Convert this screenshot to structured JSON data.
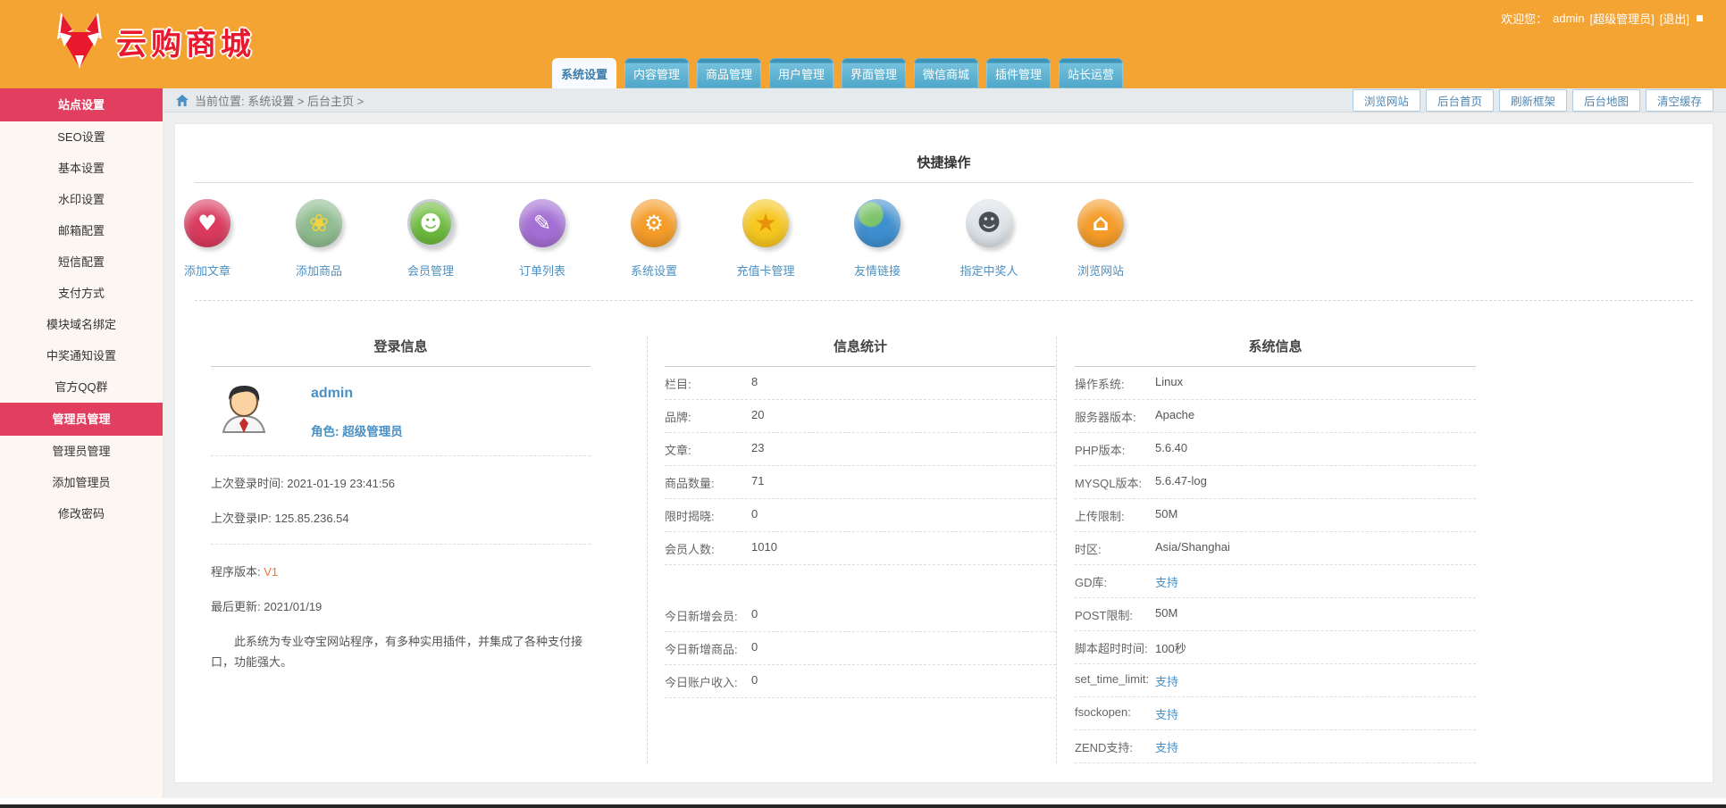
{
  "colors": {
    "header_bg": "#F3A433",
    "accent_pink": "#E23E60",
    "tab_blue": "#55A9CC",
    "link_blue": "#4A90C4",
    "version_orange": "#E87540"
  },
  "header": {
    "logo_text": "云购商城",
    "welcome_prefix": "欢迎您：",
    "username": "admin",
    "role_badge": "[超级管理员]",
    "logout": "[退出]"
  },
  "tabs": [
    {
      "label": "系统设置",
      "active": true
    },
    {
      "label": "内容管理",
      "active": false
    },
    {
      "label": "商品管理",
      "active": false
    },
    {
      "label": "用户管理",
      "active": false
    },
    {
      "label": "界面管理",
      "active": false
    },
    {
      "label": "微信商城",
      "active": false
    },
    {
      "label": "插件管理",
      "active": false
    },
    {
      "label": "站长运营",
      "active": false
    }
  ],
  "breadcrumb": {
    "text": "当前位置: 系统设置 > 后台主页 >"
  },
  "toolbar": {
    "browse_site": "浏览网站",
    "admin_home": "后台首页",
    "refresh_frame": "刷新框架",
    "admin_map": "后台地图",
    "clear_cache": "清空缓存"
  },
  "sidebar": {
    "items": [
      {
        "label": "站点设置",
        "active": true
      },
      {
        "label": "SEO设置",
        "active": false
      },
      {
        "label": "基本设置",
        "active": false
      },
      {
        "label": "水印设置",
        "active": false
      },
      {
        "label": "邮箱配置",
        "active": false
      },
      {
        "label": "短信配置",
        "active": false
      },
      {
        "label": "支付方式",
        "active": false
      },
      {
        "label": "模块域名绑定",
        "active": false
      },
      {
        "label": "中奖通知设置",
        "active": false
      },
      {
        "label": "官方QQ群",
        "active": false
      },
      {
        "label": "管理员管理",
        "active": true
      },
      {
        "label": "管理员管理",
        "active": false
      },
      {
        "label": "添加管理员",
        "active": false
      },
      {
        "label": "修改密码",
        "active": false
      }
    ]
  },
  "quick_ops": {
    "title": "快捷操作",
    "items": [
      {
        "label": "添加文章",
        "glyph": "♥",
        "color": "#D93A5E"
      },
      {
        "label": "添加商品",
        "glyph": "❀",
        "color": "#8FBC8F"
      },
      {
        "label": "会员管理",
        "glyph": "☻",
        "color": "#6DBB3C"
      },
      {
        "label": "订单列表",
        "glyph": "✎",
        "color": "#A46FD4"
      },
      {
        "label": "系统设置",
        "glyph": "⚙",
        "color": "#F59C28"
      },
      {
        "label": "充值卡管理",
        "glyph": "★",
        "color": "#F6C71F"
      },
      {
        "label": "友情链接",
        "glyph": "",
        "color": "#3E8FD0"
      },
      {
        "label": "指定中奖人",
        "glyph": "☻",
        "color": "#DDE3E8"
      },
      {
        "label": "浏览网站",
        "glyph": "⌂",
        "color": "#F59C28"
      }
    ]
  },
  "login_panel": {
    "title": "登录信息",
    "username": "admin",
    "role_line": "角色: 超级管理员",
    "last_login_time": "上次登录时间: 2021-01-19 23:41:56",
    "last_login_ip": "上次登录IP: 125.85.236.54",
    "version_label": "程序版本: ",
    "version_value": "V1",
    "last_update": "最后更新: 2021/01/19",
    "description": "此系统为专业夺宝网站程序，有多种实用插件，并集成了各种支付接口，功能强大。"
  },
  "stats_panel": {
    "title": "信息统计",
    "rows": [
      {
        "label": "栏目:",
        "value": "8"
      },
      {
        "label": "品牌:",
        "value": "20"
      },
      {
        "label": "文章:",
        "value": "23"
      },
      {
        "label": "商品数量:",
        "value": "71"
      },
      {
        "label": "限时揭晓:",
        "value": "0"
      },
      {
        "label": "会员人数:",
        "value": "1010"
      }
    ],
    "today_rows": [
      {
        "label": "今日新增会员:",
        "value": "0"
      },
      {
        "label": "今日新增商品:",
        "value": "0"
      },
      {
        "label": "今日账户收入:",
        "value": "0"
      }
    ]
  },
  "system_panel": {
    "title": "系统信息",
    "rows": [
      {
        "label": "操作系统:",
        "value": "Linux",
        "link": false
      },
      {
        "label": "服务器版本:",
        "value": "Apache",
        "link": false
      },
      {
        "label": "PHP版本:",
        "value": "5.6.40",
        "link": false
      },
      {
        "label": "MYSQL版本:",
        "value": "5.6.47-log",
        "link": false
      },
      {
        "label": "上传限制:",
        "value": "50M",
        "link": false
      },
      {
        "label": "时区:",
        "value": "Asia/Shanghai",
        "link": false
      },
      {
        "label": "GD库:",
        "value": "支持",
        "link": true
      },
      {
        "label": "POST限制:",
        "value": "50M",
        "link": false
      },
      {
        "label": "脚本超时时间:",
        "value": "100秒",
        "link": false
      },
      {
        "label": "set_time_limit:",
        "value": "支持",
        "link": true
      },
      {
        "label": "fsockopen:",
        "value": "支持",
        "link": true
      },
      {
        "label": "ZEND支持:",
        "value": "支持",
        "link": true
      }
    ]
  }
}
